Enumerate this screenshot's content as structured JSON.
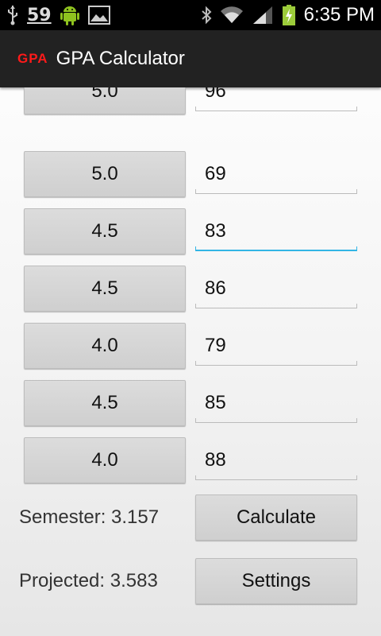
{
  "status_bar": {
    "notification_count": "59",
    "time": "6:35 PM",
    "icons_left": [
      "usb-icon",
      "android-icon",
      "image-icon"
    ],
    "icons_right": [
      "bluetooth-icon",
      "wifi-icon",
      "signal-icon",
      "battery-charging-icon"
    ]
  },
  "action_bar": {
    "logo_text": "GPA",
    "title": "GPA Calculator",
    "logo_color": "#ff1a1a"
  },
  "rows": [
    {
      "weight": "5.0",
      "grade": "96"
    },
    {
      "weight": "5.0",
      "grade": "69"
    },
    {
      "weight": "4.5",
      "grade": "83"
    },
    {
      "weight": "4.5",
      "grade": "86"
    },
    {
      "weight": "4.0",
      "grade": "79"
    },
    {
      "weight": "4.5",
      "grade": "85"
    },
    {
      "weight": "4.0",
      "grade": "88"
    }
  ],
  "results": {
    "semester_label": "Semester: 3.157",
    "projected_label": "Projected: 3.583",
    "calculate_button": "Calculate",
    "settings_button": "Settings"
  },
  "colors": {
    "focus_accent": "#33b5e5",
    "action_bar_bg": "#222222"
  }
}
